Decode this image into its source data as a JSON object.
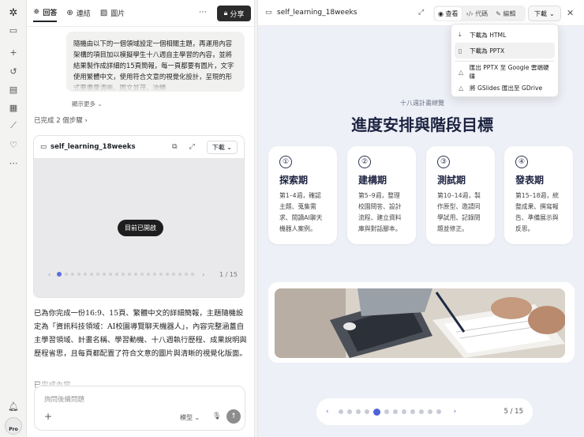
{
  "rail": {
    "pro_label": "Pro"
  },
  "chat": {
    "tabs": [
      {
        "label": "回答",
        "icon": "sparkle-icon"
      },
      {
        "label": "連結",
        "icon": "globe-icon"
      },
      {
        "label": "圖片",
        "icon": "image-icon"
      }
    ],
    "share_label": "分享",
    "user_message": "隨機由以下的一個領域設定一個相關主題，再運用內容架構的項目加以模擬學生十八週自主學習的內容，並將結果製作成詳細的15頁簡報，每一頁都要有圖片，文字使用繁體中文，使用符合文意的視覺化設計，呈現的形式要盡量清晰、圖文並茂，流暢",
    "show_more": "顯示更多",
    "steps_done": "已完成 2 個步驟",
    "card": {
      "file_name": "self_learning_18weeks",
      "download_label": "下載",
      "opened_pill": "目前已開啟",
      "page": "1 / 15"
    },
    "answer": "已為你完成一份16:9、15頁、繁體中文的詳細簡報，主題隨機設定為「資訊科技領域：AI校園導覽聊天機器人」，內容完整涵蓋自主學習領域、計畫名稱、學習動機、十八週執行歷程、成果說明與歷程省思，且每頁都配置了符合文意的圖片與清晰的視覺化版面。",
    "answer_more": "已完成內容",
    "composer": {
      "placeholder": "詢問後續問題",
      "model_label": "模型"
    }
  },
  "preview": {
    "file_name": "self_learning_18weeks",
    "seg": {
      "view": "查看",
      "code": "代碼",
      "edit": "編輯"
    },
    "download_label": "下載",
    "slide": {
      "kicker": "十八週計畫總覽",
      "title": "進度安排與階段目標",
      "phases": [
        {
          "num": "①",
          "name": "探索期",
          "desc": "第1–4週，確認主題、蒐集需求、閱讀AI聊天機器人案例。"
        },
        {
          "num": "②",
          "name": "建構期",
          "desc": "第5–9週，整理校園問答、設計流程、建立資料庫與對話腳本。"
        },
        {
          "num": "③",
          "name": "測試期",
          "desc": "第10–14週，製作原型、邀請同學試用、記錄問題並修正。"
        },
        {
          "num": "④",
          "name": "發表期",
          "desc": "第15–18週，統整成果、撰寫報告、準備展示與反思。"
        }
      ]
    },
    "page": "5 / 15",
    "current_page": 5,
    "total_pages": 15
  },
  "menu": {
    "items": [
      {
        "label": "下載為 HTML",
        "icon": "download-icon"
      },
      {
        "label": "下載為 PPTX",
        "icon": "file-icon"
      },
      {
        "label": "匯出 PPTX 至 Google 雲端硬碟",
        "icon": "drive-icon"
      },
      {
        "label": "將 GSlides 匯出至 GDrive",
        "icon": "drive-icon"
      }
    ]
  }
}
